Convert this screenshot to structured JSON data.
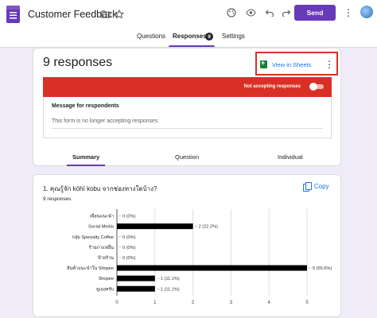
{
  "header": {
    "title": "Customer Feedback",
    "send_label": "Send"
  },
  "tabs": [
    {
      "label": "Questions"
    },
    {
      "label": "Responses"
    },
    {
      "label": "Settings"
    }
  ],
  "responses_badge": "9",
  "summary_card": {
    "count_label": "9 responses",
    "sheets_label": "View in Sheets",
    "accepting_label": "Not accepting responses",
    "accepting": false,
    "message_label": "Message for respondents",
    "message_text": "This form is no longer accepting responses",
    "view_tabs": [
      "Summary",
      "Question",
      "Individual"
    ]
  },
  "question": {
    "title": "1. คุณรู้จัก kōhī kobu จากช่องทางใดบ้าง?",
    "response_count": "9 responses",
    "copy_label": "Copy"
  },
  "colors": {
    "brand": "#673ab7",
    "alert": "#d93025",
    "link": "#1a73e8",
    "bar": "#000000"
  },
  "chart_data": {
    "type": "bar",
    "orientation": "horizontal",
    "categories": [
      "เพื่อนแนะนำ",
      "Social Media",
      "กลุ่ม Specialty Coffee",
      "ร้านกาแฟอื่น",
      "ป้ายร้าน",
      "สินค้าแนะนำใน Shopee",
      "Shopee",
      "ดูเองครับ"
    ],
    "values": [
      0,
      2,
      0,
      0,
      0,
      5,
      1,
      1
    ],
    "data_labels": [
      "0 (0%)",
      "2 (22.2%)",
      "0 (0%)",
      "0 (0%)",
      "0 (0%)",
      "5 (55.6%)",
      "1 (11.1%)",
      "1 (11.1%)"
    ],
    "xticks": [
      "0",
      "1",
      "2",
      "3",
      "4",
      "5"
    ],
    "xlim": [
      0,
      5
    ],
    "grid": true
  }
}
